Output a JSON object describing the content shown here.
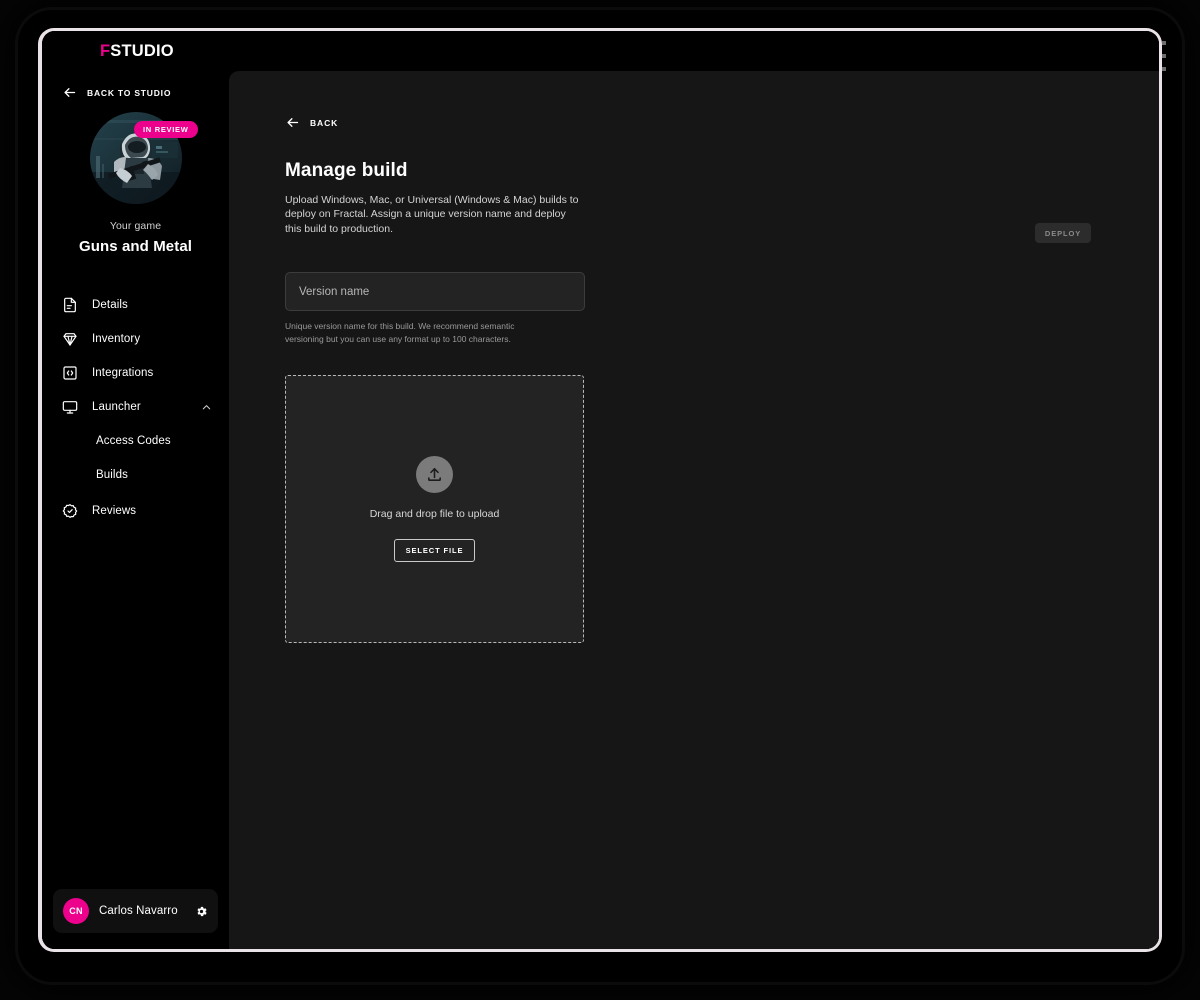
{
  "app": {
    "logo_accent_letter": "F",
    "logo_rest": "STUDIO",
    "accent_color": "#ec008c"
  },
  "sidebar": {
    "back_to_studio": "BACK TO STUDIO",
    "badge": "IN REVIEW",
    "your_game_label": "Your game",
    "game_title": "Guns and Metal",
    "nav": [
      {
        "label": "Details",
        "icon": "document-icon"
      },
      {
        "label": "Inventory",
        "icon": "gem-icon"
      },
      {
        "label": "Integrations",
        "icon": "code-box-icon"
      },
      {
        "label": "Launcher",
        "icon": "monitor-icon",
        "expanded": true
      },
      {
        "label": "Reviews",
        "icon": "check-badge-icon"
      }
    ],
    "nav_sub": [
      {
        "label": "Access Codes"
      },
      {
        "label": "Builds"
      }
    ],
    "user": {
      "initials": "CN",
      "name": "Carlos Navarro",
      "settings_icon": "gear-icon"
    }
  },
  "main": {
    "back_label": "BACK",
    "title": "Manage build",
    "description": "Upload Windows, Mac, or Universal (Windows & Mac) builds to deploy on Fractal. Assign a unique version name and deploy this build to production.",
    "deploy_label": "DEPLOY",
    "version_field": {
      "value": "",
      "placeholder": "Version name",
      "help": "Unique version name for this build. We recommend semantic versioning but you can use any format up to 100 characters."
    },
    "dropzone": {
      "icon": "upload-icon",
      "text": "Drag and drop file to upload",
      "button_label": "SELECT FILE"
    }
  }
}
